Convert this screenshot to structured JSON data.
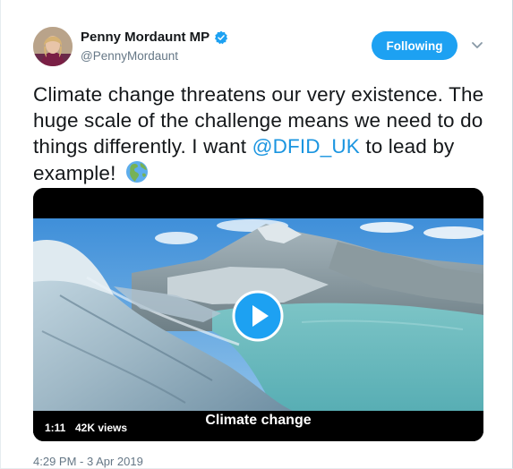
{
  "author": {
    "display_name": "Penny Mordaunt MP",
    "handle": "@PennyMordaunt",
    "verified": true
  },
  "follow_button": {
    "label": "Following",
    "color": "#1da1f2"
  },
  "tweet": {
    "text_before": "Climate change threatens our very existence. The huge scale of the challenge means we need to do things differently. I want ",
    "mention": "@DFID_UK",
    "text_after": " to lead by example! ",
    "emoji": "globe-americas-icon",
    "mention_color": "#1b95e0"
  },
  "video": {
    "duration": "1:11",
    "views": "42K views",
    "caption": "Climate change"
  },
  "timestamp": "4:29 PM - 3 Apr 2019"
}
